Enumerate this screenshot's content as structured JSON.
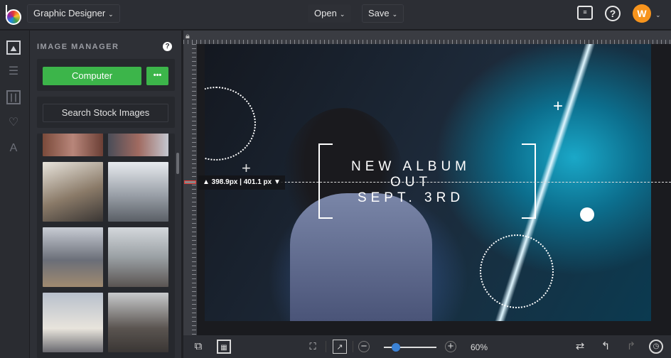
{
  "header": {
    "app_menu": "Graphic Designer",
    "open_label": "Open",
    "save_label": "Save",
    "avatar_initial": "W"
  },
  "rail": {
    "items": [
      "image-icon",
      "sliders-icon",
      "columns-icon",
      "heart-icon",
      "text-icon"
    ]
  },
  "panel": {
    "title": "IMAGE MANAGER",
    "computer_label": "Computer",
    "more_label": "•••",
    "search_stock_label": "Search Stock Images"
  },
  "canvas": {
    "measure": "▲ 398.9px | 401.1 px ▼",
    "line1": "NEW ALBUM",
    "line2": "OUT",
    "line3": "SEPT. 3RD"
  },
  "bottom": {
    "zoom_label": "60%",
    "zoom_percent": 60
  },
  "colors": {
    "accent_green": "#3cb54a",
    "avatar": "#f7941d",
    "slider": "#3b82d6"
  }
}
